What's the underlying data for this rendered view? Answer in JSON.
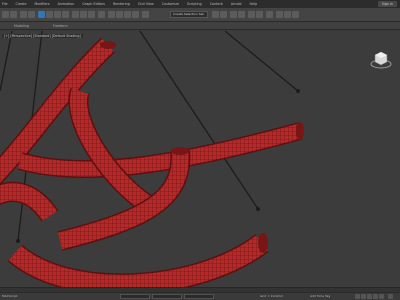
{
  "menubar": {
    "items": [
      "File",
      "Create",
      "Modifiers",
      "Animation",
      "Graph Editors",
      "Rendering",
      "Civil View",
      "Customize",
      "Scripting",
      "Content",
      "Arnold",
      "Help"
    ],
    "signin": "Sign In"
  },
  "toolbar": {
    "selection_set": "Create Selection Set"
  },
  "ribbon": {
    "tabs": [
      "Modeling",
      "Freeform"
    ]
  },
  "viewport": {
    "label": "[+] [Perspective] [Standard] [Default Shading]",
    "object_color": "#b22a2a"
  },
  "statusbar": {
    "left_text": "MAXScript",
    "grid_text": "Grid = 10,0mm",
    "time_tag": "Add Time Tag"
  }
}
